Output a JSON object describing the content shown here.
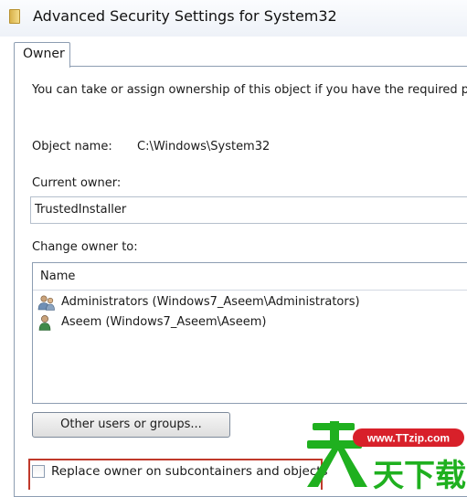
{
  "window": {
    "title": "Advanced Security Settings for System32"
  },
  "tabs": [
    {
      "label": "Owner"
    }
  ],
  "owner_panel": {
    "description": "You can take or assign ownership of this object if you have the required per",
    "object_name_label": "Object name:",
    "object_name_value": "C:\\Windows\\System32",
    "current_owner_label": "Current owner:",
    "current_owner_value": "TrustedInstaller",
    "change_owner_label": "Change owner to:",
    "list_header": "Name",
    "owners": [
      {
        "name": "Administrators (Windows7_Aseem\\Administrators)",
        "icon": "group-users-icon"
      },
      {
        "name": "Aseem (Windows7_Aseem\\Aseem)",
        "icon": "user-icon"
      }
    ],
    "other_users_button": "Other users or groups...",
    "replace_owner_label": "Replace owner on subcontainers and objects",
    "replace_owner_checked": false
  },
  "watermark": {
    "url": "www.TTzip.com",
    "chars": "天下载"
  },
  "colors": {
    "highlight_border": "#c0392b",
    "watermark_green": "#1fb01f",
    "watermark_red": "#d8202a"
  }
}
